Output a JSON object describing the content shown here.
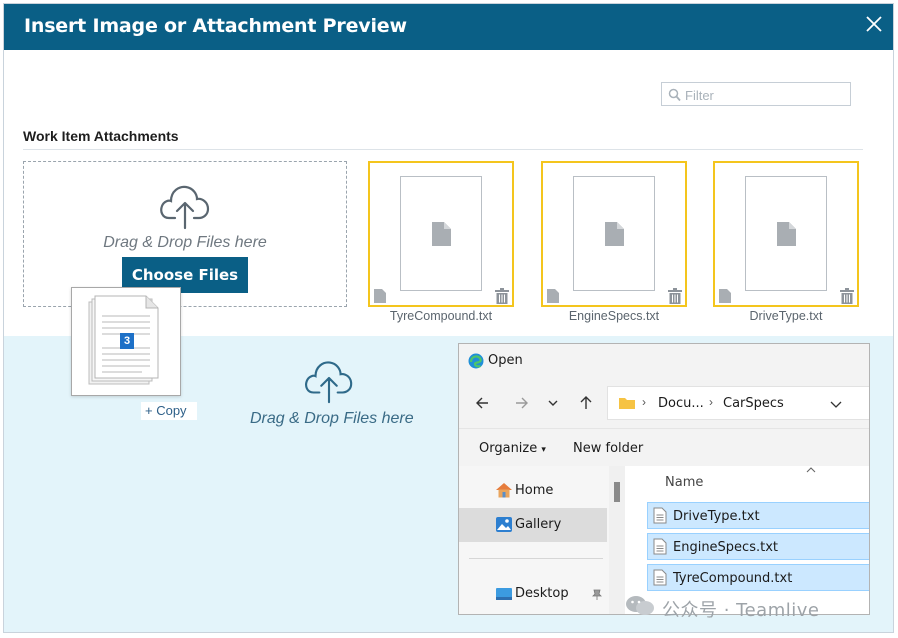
{
  "dialog": {
    "title": "Insert Image or Attachment Preview",
    "close_icon": "close-icon"
  },
  "filter": {
    "placeholder": "Filter",
    "icon": "search-icon"
  },
  "attachments": {
    "section_title": "Work Item Attachments",
    "drop_text": "Drag & Drop Files here",
    "choose_button": "Choose Files",
    "files": [
      {
        "name": "TyreCompound.txt"
      },
      {
        "name": "EngineSpecs.txt"
      },
      {
        "name": "DriveType.txt"
      }
    ]
  },
  "drop_zone": {
    "text": "Drag & Drop Files here"
  },
  "drag_preview": {
    "count": "3",
    "copy_label": "+ Copy"
  },
  "explorer": {
    "title": "Open",
    "breadcrumb": [
      "Docu...",
      "CarSpecs"
    ],
    "organize": "Organize",
    "new_folder": "New folder",
    "nav_items": [
      {
        "label": "Home"
      },
      {
        "label": "Gallery"
      },
      {
        "label": "Desktop"
      }
    ],
    "column_name": "Name",
    "files": [
      {
        "name": "DriveType.txt"
      },
      {
        "name": "EngineSpecs.txt"
      },
      {
        "name": "TyreCompound.txt"
      }
    ]
  },
  "watermark": {
    "text": "公众号 · Teamlive"
  },
  "colors": {
    "title_bar": "#0a5f86",
    "selection_border": "#f4c51d",
    "drop_zone_bg": "#e3f4fa",
    "explorer_selected": "#cce8ff"
  }
}
